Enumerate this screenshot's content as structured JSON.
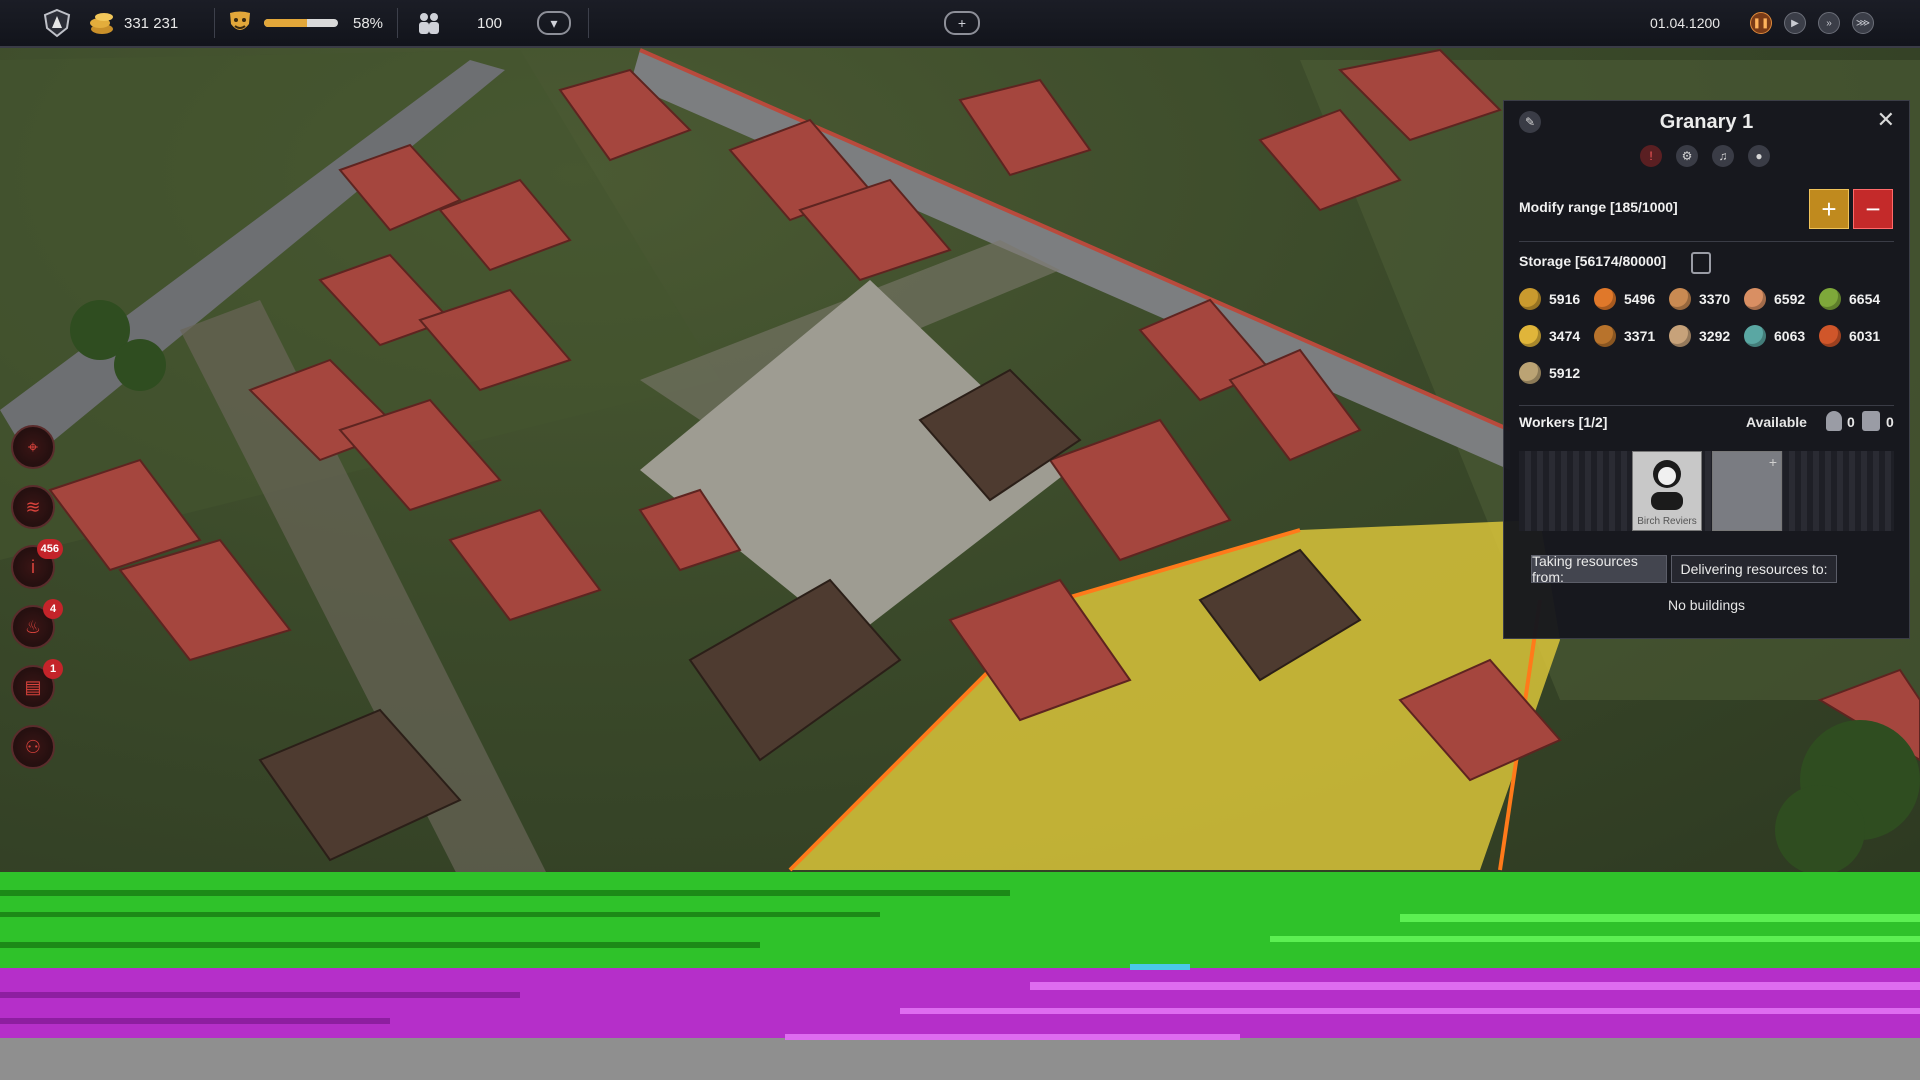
{
  "topbar": {
    "gold": "331 231",
    "happiness_percent": "58%",
    "happiness_level": 0.58,
    "population": "100",
    "date": "01.04.1200",
    "icons": {
      "emblem": "faction-shield-icon",
      "gold": "coin-stack-icon",
      "happiness": "mask-icon",
      "population": "people-icon",
      "dropdown": "chevron-down-icon",
      "add": "plus-icon",
      "speeds": [
        "pause-icon",
        "play-icon",
        "fast-forward-icon",
        "fastest-forward-icon"
      ]
    }
  },
  "left_buttons": [
    {
      "name": "target-button",
      "icon": "crosshair-icon",
      "glyph": "⌖",
      "badge": ""
    },
    {
      "name": "layers-button",
      "icon": "layers-icon",
      "glyph": "≋",
      "badge": ""
    },
    {
      "name": "info-button",
      "icon": "info-icon",
      "glyph": "i",
      "badge": "456"
    },
    {
      "name": "fire-button",
      "icon": "fire-icon",
      "glyph": "♨",
      "badge": "4"
    },
    {
      "name": "quests-button",
      "icon": "book-icon",
      "glyph": "▤",
      "badge": "1"
    },
    {
      "name": "workers-button",
      "icon": "people-icon",
      "glyph": "⚇",
      "badge": ""
    }
  ],
  "panel": {
    "title": "Granary 1",
    "icons": [
      "edit-icon",
      "alert-icon",
      "gear-icon",
      "bell-icon",
      "location-pin-icon",
      "close-icon"
    ],
    "modify_range": "Modify range [185/1000]",
    "storage": "Storage [56174/80000]",
    "resources": [
      {
        "icon": "grain-icon",
        "value": "5916",
        "color": "#c99a2e"
      },
      {
        "icon": "carrot-icon",
        "value": "5496",
        "color": "#e0782a"
      },
      {
        "icon": "bread-icon",
        "value": "3370",
        "color": "#c98a52"
      },
      {
        "icon": "meat-icon",
        "value": "6592",
        "color": "#d98f63"
      },
      {
        "icon": "herbs-icon",
        "value": "6654",
        "color": "#7ea83a"
      },
      {
        "icon": "cheese-icon",
        "value": "3474",
        "color": "#e0b53a"
      },
      {
        "icon": "honey-icon",
        "value": "3371",
        "color": "#b8732c"
      },
      {
        "icon": "sausage-icon",
        "value": "3292",
        "color": "#c7a27a"
      },
      {
        "icon": "fish-icon",
        "value": "6063",
        "color": "#5aa7a3"
      },
      {
        "icon": "apple-icon",
        "value": "6031",
        "color": "#d0562a"
      },
      {
        "icon": "sack-icon",
        "value": "5912",
        "color": "#bba374"
      }
    ],
    "workers_label": "Workers [1/2]",
    "available_label": "Available",
    "available_a": "0",
    "available_b": "0",
    "worker_name": "Birch Reviers",
    "taking_from": "Taking resources from:",
    "delivering_to": "Delivering resources to:",
    "no_buildings": "No buildings"
  },
  "glitch_colors": {
    "green": "#2fc22a",
    "magenta": "#b52fc9",
    "grey": "#8f8f8f"
  }
}
